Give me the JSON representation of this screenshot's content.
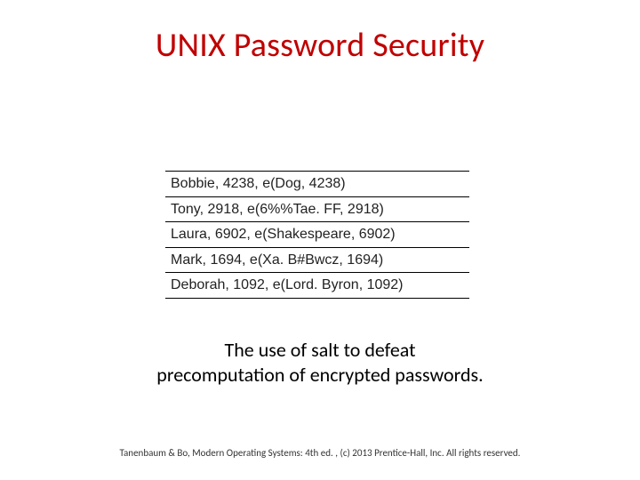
{
  "slide": {
    "title": "UNIX Password Security",
    "caption_line1": "The use of salt to defeat",
    "caption_line2": "precomputation of encrypted passwords.",
    "footer": "Tanenbaum & Bo, Modern Operating Systems: 4th ed. , (c) 2013 Prentice-Hall, Inc. All rights reserved."
  },
  "table": {
    "rows": [
      "Bobbie, 4238, e(Dog, 4238)",
      "Tony, 2918, e(6%%Tae. FF, 2918)",
      "Laura, 6902, e(Shakespeare, 6902)",
      "Mark, 1694, e(Xa. B#Bwcz, 1694)",
      "Deborah, 1092, e(Lord. Byron, 1092)"
    ]
  }
}
